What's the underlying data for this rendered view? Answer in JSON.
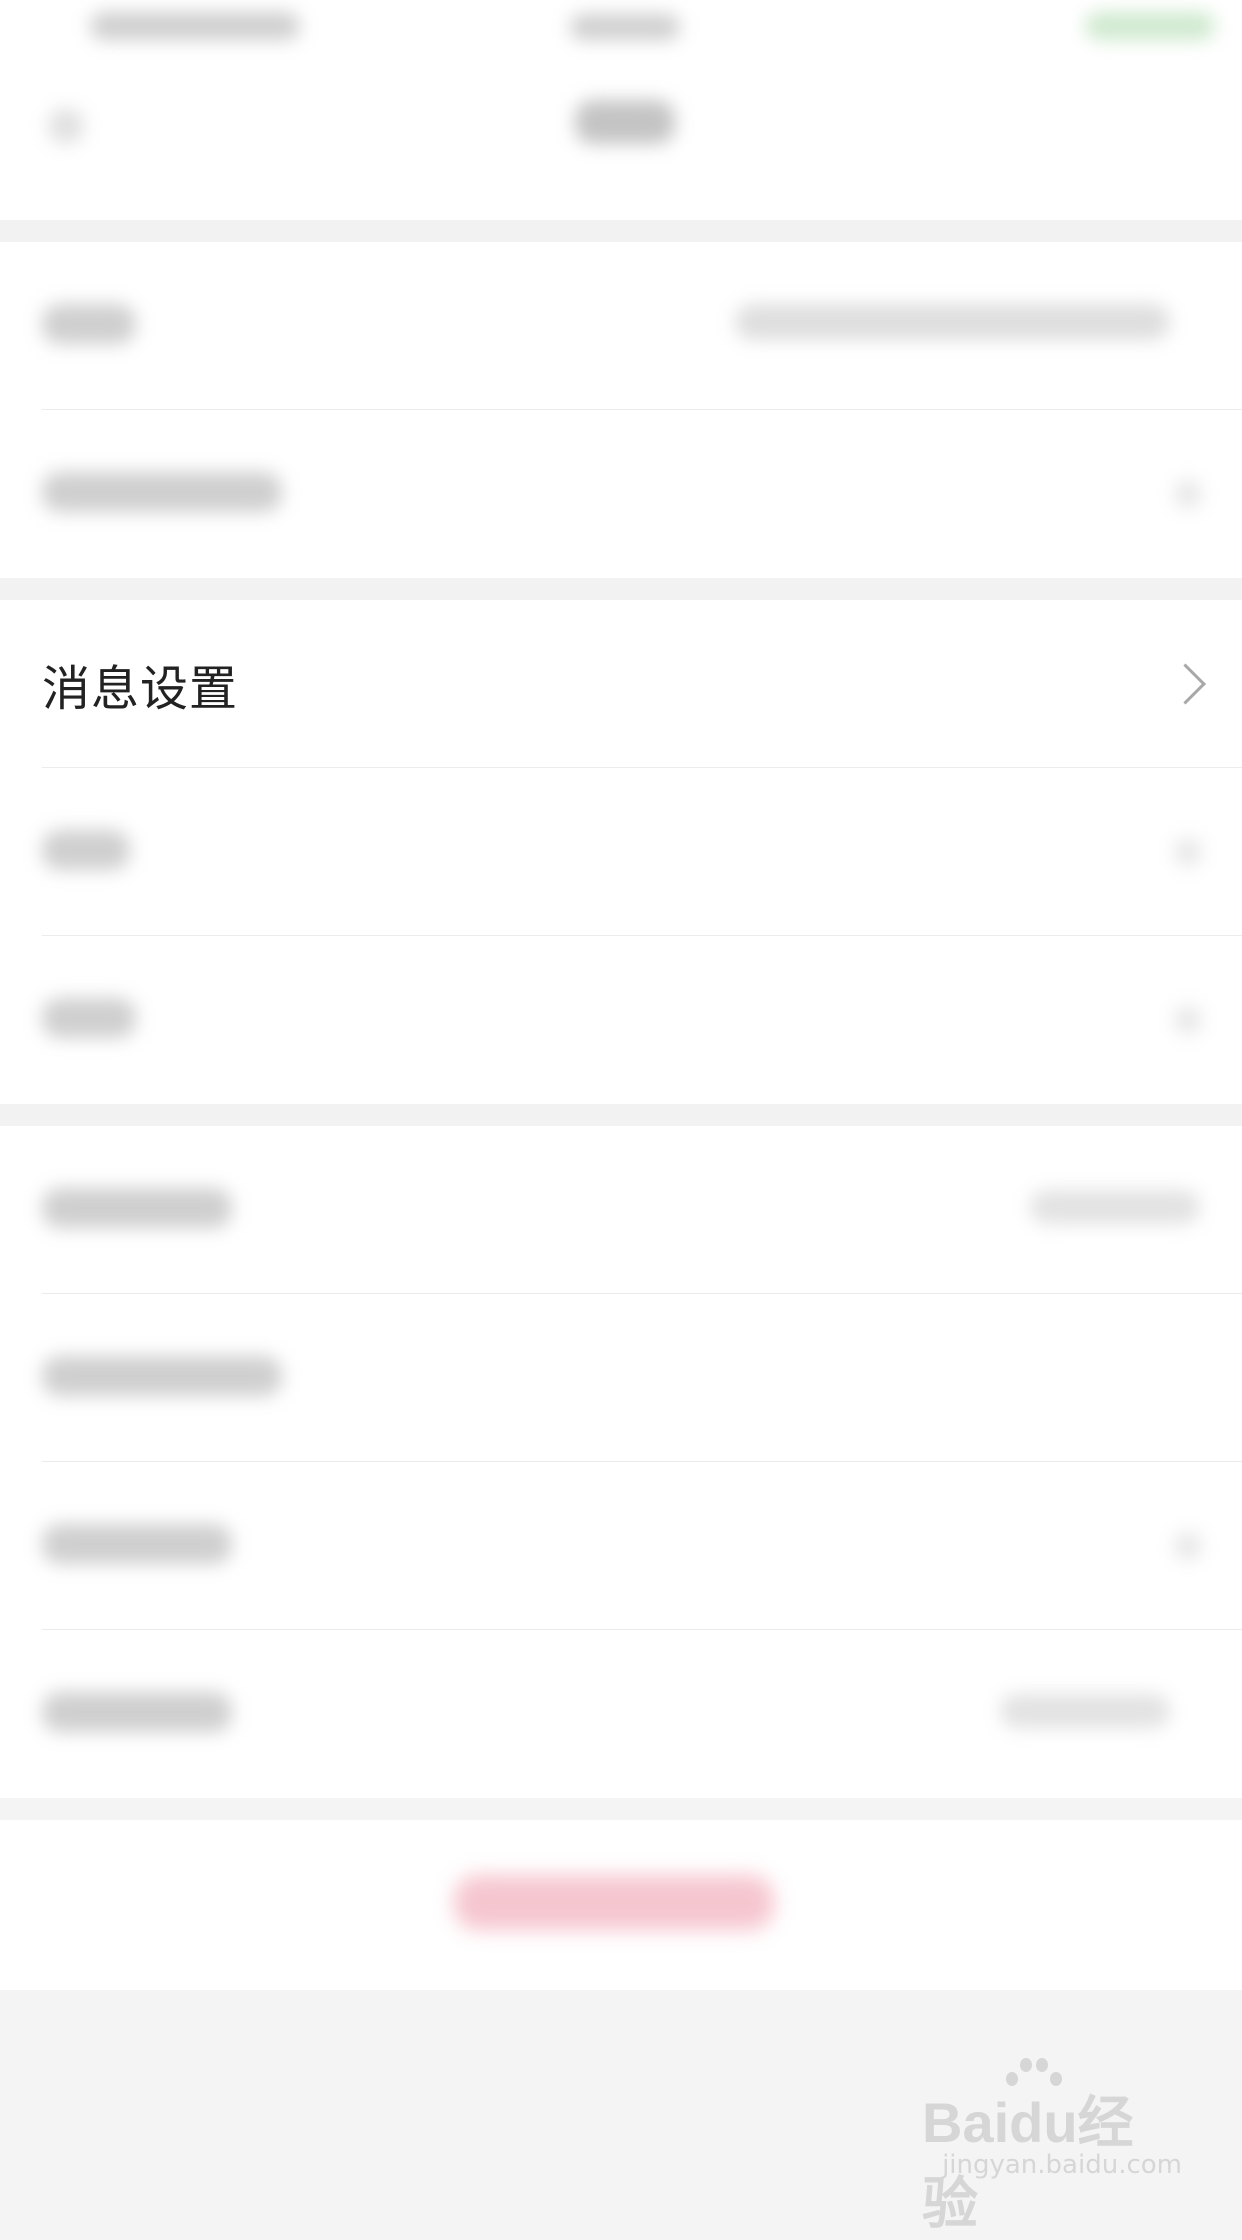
{
  "settings": {
    "visible_row": {
      "label": "消息设置",
      "icon": "chevron-right-icon"
    }
  },
  "watermark": {
    "brand": "Baidu经验",
    "url": "jingyan.baidu.com"
  },
  "colors": {
    "background": "#f4f4f4",
    "surface": "#ffffff",
    "text": "#222222",
    "chevron": "#a8a8a8",
    "danger_tint": "#f6c6cf",
    "status_accent": "#8fd68f"
  }
}
